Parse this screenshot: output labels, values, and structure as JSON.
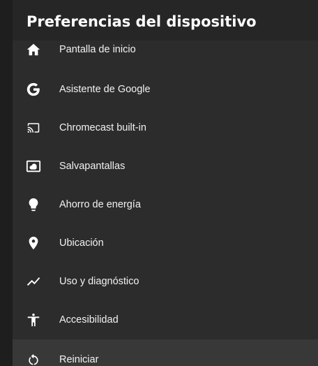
{
  "header": {
    "title": "Preferencias del dispositivo"
  },
  "menu": {
    "selected_index": 8,
    "items": [
      {
        "label": "Pantalla de inicio",
        "icon": "home-icon"
      },
      {
        "label": "Asistente de Google",
        "icon": "google-g-icon"
      },
      {
        "label": "Chromecast built-in",
        "icon": "cast-icon"
      },
      {
        "label": "Salvapantallas",
        "icon": "screensaver-icon"
      },
      {
        "label": "Ahorro de energía",
        "icon": "lightbulb-icon"
      },
      {
        "label": "Ubicación",
        "icon": "location-pin-icon"
      },
      {
        "label": "Uso y diagnóstico",
        "icon": "trending-line-icon"
      },
      {
        "label": "Accesibilidad",
        "icon": "accessibility-icon"
      },
      {
        "label": "Reiniciar",
        "icon": "restart-icon"
      }
    ]
  }
}
